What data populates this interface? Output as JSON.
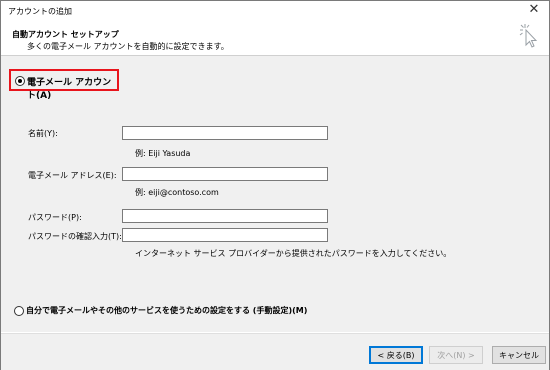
{
  "window": {
    "title": "アカウントの追加",
    "close_glyph": "✕"
  },
  "header": {
    "title": "自動アカウント セットアップ",
    "subtitle": "多くの電子メール アカウントを自動的に設定できます。"
  },
  "options": {
    "email_account_label": "電子メール アカウント(A)",
    "manual_setup_label": "自分で電子メールやその他のサービスを使うための設定をする (手動設定)(M)"
  },
  "form": {
    "name": {
      "label": "名前(Y):",
      "value": "",
      "example": "例: Eiji Yasuda"
    },
    "email": {
      "label": "電子メール アドレス(E):",
      "value": "",
      "example": "例: eiji@contoso.com"
    },
    "password": {
      "label": "パスワード(P):",
      "value": ""
    },
    "password_confirm": {
      "label": "パスワードの確認入力(T):",
      "value": ""
    },
    "password_hint": "インターネット サービス プロバイダーから提供されたパスワードを入力してください。"
  },
  "buttons": {
    "back": "< 戻る(B)",
    "next": "次へ(N) >",
    "cancel": "キャンセル"
  },
  "colors": {
    "highlight_border": "#e8141c",
    "focus_blue": "#0078d7"
  }
}
